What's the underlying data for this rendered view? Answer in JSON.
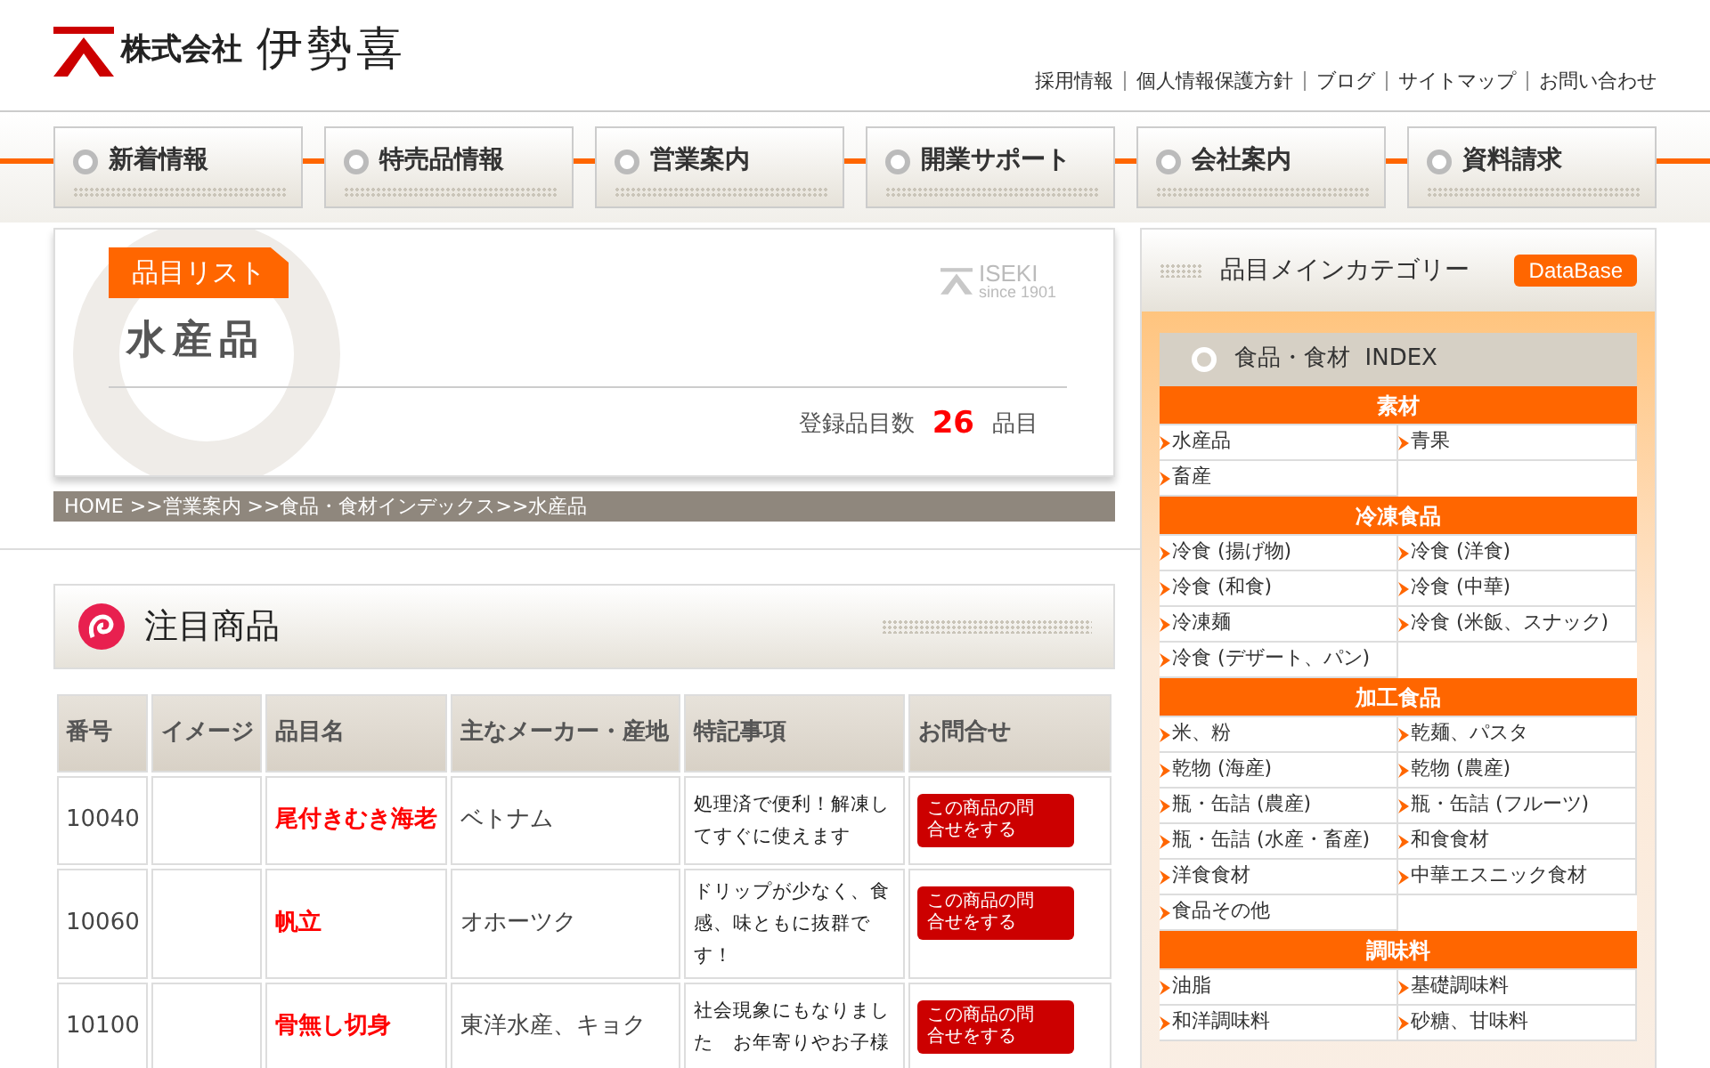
{
  "logo": {
    "company": "株式会社",
    "name": "伊勢喜"
  },
  "util_links": [
    "採用情報",
    "個人情報保護方針",
    "ブログ",
    "サイトマップ",
    "お問い合わせ"
  ],
  "nav": [
    {
      "label": "新着情報"
    },
    {
      "label": "特売品情報"
    },
    {
      "label": "営業案内"
    },
    {
      "label": "開業サポート"
    },
    {
      "label": "会社案内"
    },
    {
      "label": "資料請求"
    }
  ],
  "title_card": {
    "tag": "品目リスト",
    "title": "水産品",
    "brand": "ISEKI",
    "since": "since 1901",
    "count_label": "登録品目数",
    "count": "26",
    "count_unit": "品目"
  },
  "breadcrumb": "HOME >>営業案内 >>食品・食材インデックス>>水産品",
  "featured": {
    "title": "注目商品"
  },
  "table": {
    "columns": [
      "番号",
      "イメージ",
      "品目名",
      "主なメーカー・産地",
      "特記事項",
      "お問合せ"
    ],
    "rows": [
      {
        "number": "10040",
        "name": "尾付きむき海老",
        "maker": "ベトナム",
        "notes": "処理済で便利！解凍してすぐに使えます",
        "button": "この商品の問合せをする"
      },
      {
        "number": "10060",
        "name": "帆立",
        "maker": "オホーツク",
        "notes": "ドリップが少なく、食感、味ともに抜群です！",
        "button": "この商品の問合せをする"
      },
      {
        "number": "10100",
        "name": "骨無し切身",
        "maker": "東洋水産、キョク",
        "notes": "社会現象にもなりました　お年寄りやお子様",
        "button": "この商品の問合せをする"
      }
    ]
  },
  "sidebar": {
    "title": "品目メインカテゴリー",
    "badge": "DataBase",
    "index_title": "食品・食材  INDEX",
    "sections": [
      {
        "heading": "素材",
        "items": [
          "水産品",
          "青果",
          "畜産"
        ]
      },
      {
        "heading": "冷凍食品",
        "items": [
          "冷食 (揚げ物)",
          "冷食 (洋食)",
          "冷食 (和食)",
          "冷食 (中華)",
          "冷凍麺",
          "冷食 (米飯、スナック)",
          "冷食 (デザート、パン)"
        ]
      },
      {
        "heading": "加工食品",
        "items": [
          "米、粉",
          "乾麺、パスタ",
          "乾物 (海産)",
          "乾物 (農産)",
          "瓶・缶詰 (農産)",
          "瓶・缶詰 (フルーツ)",
          "瓶・缶詰 (水産・畜産)",
          "和食食材",
          "洋食食材",
          "中華エスニック食材",
          "食品その他"
        ]
      },
      {
        "heading": "調味料",
        "items": [
          "油脂",
          "基礎調味料",
          "和洋調味料",
          "砂糖、甘味料"
        ]
      }
    ]
  }
}
